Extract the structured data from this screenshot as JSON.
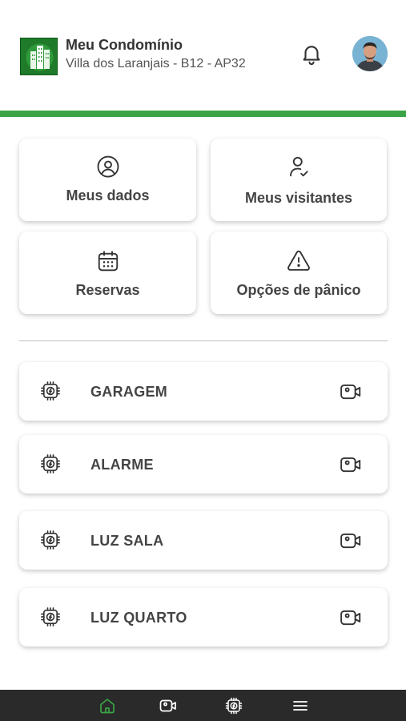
{
  "header": {
    "title": "Meu Condomínio",
    "subtitle": "Villa dos Laranjais - B12 - AP32",
    "icons": {
      "notifications": "bell-icon",
      "profile": "avatar"
    }
  },
  "quick_actions": [
    {
      "label": "Meus dados",
      "icon": "user-circle-icon"
    },
    {
      "label": "Meus visitantes",
      "icon": "user-check-icon"
    },
    {
      "label": "Reservas",
      "icon": "calendar-icon"
    },
    {
      "label": "Opções de pânico",
      "icon": "warning-icon"
    }
  ],
  "devices": [
    {
      "label": "GARAGEM",
      "icon": "chip-icon",
      "action_icon": "camera-icon"
    },
    {
      "label": "ALARME",
      "icon": "chip-icon",
      "action_icon": "camera-icon"
    },
    {
      "label": "LUZ SALA",
      "icon": "chip-icon",
      "action_icon": "camera-icon"
    },
    {
      "label": "LUZ QUARTO",
      "icon": "chip-icon",
      "action_icon": "camera-icon"
    }
  ],
  "bottom_nav": {
    "items": [
      {
        "icon": "home-icon",
        "active": true
      },
      {
        "icon": "camera-icon",
        "active": false
      },
      {
        "icon": "chip-icon",
        "active": false
      },
      {
        "icon": "menu-icon",
        "active": false
      }
    ]
  },
  "colors": {
    "accent": "#3aa447",
    "nav_background": "#2a2a2a",
    "card_background": "#ffffff",
    "text": "#444444"
  }
}
